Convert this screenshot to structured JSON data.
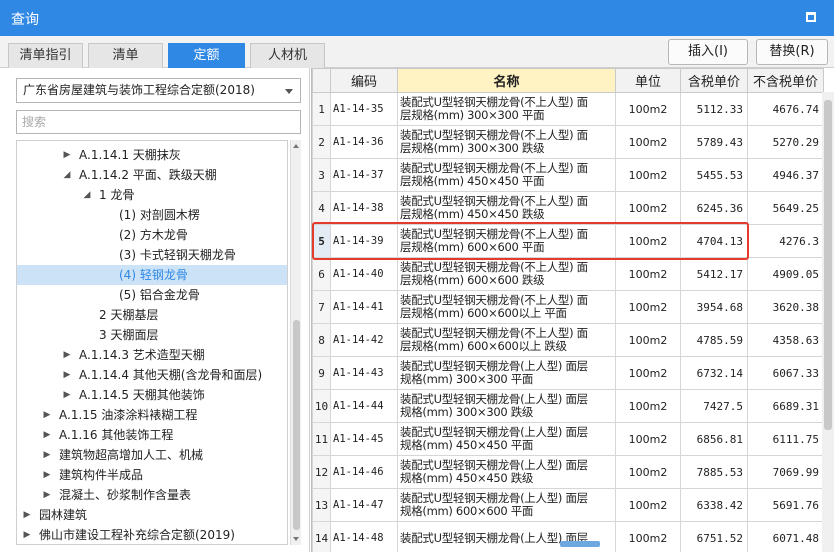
{
  "window": {
    "title": "查询"
  },
  "tabs": [
    {
      "label": "清单指引",
      "active": false
    },
    {
      "label": "清单",
      "active": false
    },
    {
      "label": "定额",
      "active": true
    },
    {
      "label": "人材机",
      "active": false
    }
  ],
  "toolbar": {
    "insert_label": "插入(I)",
    "replace_label": "替换(R)"
  },
  "left": {
    "quota_selected": "广东省房屋建筑与装饰工程综合定额(2018)",
    "search_placeholder": "搜索"
  },
  "tree": [
    {
      "label": "A.1.14.1 天棚抹灰",
      "level": 3,
      "toggle": "collapsed",
      "selected": false
    },
    {
      "label": "A.1.14.2 平面、跌级天棚",
      "level": 3,
      "toggle": "expanded",
      "selected": false
    },
    {
      "label": "1 龙骨",
      "level": 4,
      "toggle": "expanded",
      "selected": false
    },
    {
      "label": "(1) 对剖圆木楞",
      "level": 5,
      "toggle": "none",
      "selected": false
    },
    {
      "label": "(2) 方木龙骨",
      "level": 5,
      "toggle": "none",
      "selected": false
    },
    {
      "label": "(3) 卡式轻钢天棚龙骨",
      "level": 5,
      "toggle": "none",
      "selected": false
    },
    {
      "label": "(4) 轻钢龙骨",
      "level": 5,
      "toggle": "none",
      "selected": true
    },
    {
      "label": "(5) 铝合金龙骨",
      "level": 5,
      "toggle": "none",
      "selected": false
    },
    {
      "label": "2 天棚基层",
      "level": 4,
      "toggle": "none",
      "selected": false
    },
    {
      "label": "3 天棚面层",
      "level": 4,
      "toggle": "none",
      "selected": false
    },
    {
      "label": "A.1.14.3 艺术造型天棚",
      "level": 3,
      "toggle": "collapsed",
      "selected": false
    },
    {
      "label": "A.1.14.4 其他天棚(含龙骨和面层)",
      "level": 3,
      "toggle": "collapsed",
      "selected": false
    },
    {
      "label": "A.1.14.5 天棚其他装饰",
      "level": 3,
      "toggle": "collapsed",
      "selected": false
    },
    {
      "label": "A.1.15 油漆涂料裱糊工程",
      "level": 2,
      "toggle": "collapsed",
      "selected": false
    },
    {
      "label": "A.1.16 其他装饰工程",
      "level": 2,
      "toggle": "collapsed",
      "selected": false
    },
    {
      "label": "建筑物超高增加人工、机械",
      "level": 2,
      "toggle": "collapsed",
      "selected": false
    },
    {
      "label": "建筑构件半成品",
      "level": 2,
      "toggle": "collapsed",
      "selected": false
    },
    {
      "label": "混凝土、砂浆制作含量表",
      "level": 2,
      "toggle": "collapsed",
      "selected": false
    },
    {
      "label": "园林建筑",
      "level": 1,
      "toggle": "collapsed",
      "selected": false
    },
    {
      "label": "佛山市建设工程补充综合定额(2019)",
      "level": 1,
      "toggle": "collapsed",
      "selected": false
    }
  ],
  "table": {
    "headers": {
      "index": "",
      "code": "编码",
      "name": "名称",
      "unit": "单位",
      "price_tax": "含税单价",
      "price_notax": "不含税单价"
    },
    "rows": [
      {
        "index": "1",
        "code": "A1-14-35",
        "name1": "装配式U型轻钢天棚龙骨(不上人型) 面",
        "name2": "层规格(mm) 300×300 平面",
        "unit": "100m2",
        "price_tax": "5112.33",
        "price_notax": "4676.74"
      },
      {
        "index": "2",
        "code": "A1-14-36",
        "name1": "装配式U型轻钢天棚龙骨(不上人型) 面",
        "name2": "层规格(mm) 300×300 跌级",
        "unit": "100m2",
        "price_tax": "5789.43",
        "price_notax": "5270.29"
      },
      {
        "index": "3",
        "code": "A1-14-37",
        "name1": "装配式U型轻钢天棚龙骨(不上人型) 面",
        "name2": "层规格(mm) 450×450 平面",
        "unit": "100m2",
        "price_tax": "5455.53",
        "price_notax": "4946.37"
      },
      {
        "index": "4",
        "code": "A1-14-38",
        "name1": "装配式U型轻钢天棚龙骨(不上人型) 面",
        "name2": "层规格(mm) 450×450 跌级",
        "unit": "100m2",
        "price_tax": "6245.36",
        "price_notax": "5649.25"
      },
      {
        "index": "5",
        "code": "A1-14-39",
        "name1": "装配式U型轻钢天棚龙骨(不上人型) 面",
        "name2": "层规格(mm) 600×600 平面",
        "unit": "100m2",
        "price_tax": "4704.13",
        "price_notax": "4276.3"
      },
      {
        "index": "6",
        "code": "A1-14-40",
        "name1": "装配式U型轻钢天棚龙骨(不上人型) 面",
        "name2": "层规格(mm) 600×600 跌级",
        "unit": "100m2",
        "price_tax": "5412.17",
        "price_notax": "4909.05"
      },
      {
        "index": "7",
        "code": "A1-14-41",
        "name1": "装配式U型轻钢天棚龙骨(不上人型) 面",
        "name2": "层规格(mm) 600×600以上 平面",
        "unit": "100m2",
        "price_tax": "3954.68",
        "price_notax": "3620.38"
      },
      {
        "index": "8",
        "code": "A1-14-42",
        "name1": "装配式U型轻钢天棚龙骨(不上人型) 面",
        "name2": "层规格(mm) 600×600以上 跌级",
        "unit": "100m2",
        "price_tax": "4785.59",
        "price_notax": "4358.63"
      },
      {
        "index": "9",
        "code": "A1-14-43",
        "name1": "装配式U型轻钢天棚龙骨(上人型) 面层",
        "name2": "规格(mm) 300×300 平面",
        "unit": "100m2",
        "price_tax": "6732.14",
        "price_notax": "6067.33"
      },
      {
        "index": "10",
        "code": "A1-14-44",
        "name1": "装配式U型轻钢天棚龙骨(上人型) 面层",
        "name2": "规格(mm) 300×300 跌级",
        "unit": "100m2",
        "price_tax": "7427.5",
        "price_notax": "6689.31"
      },
      {
        "index": "11",
        "code": "A1-14-45",
        "name1": "装配式U型轻钢天棚龙骨(上人型) 面层",
        "name2": "规格(mm) 450×450 平面",
        "unit": "100m2",
        "price_tax": "6856.81",
        "price_notax": "6111.75"
      },
      {
        "index": "12",
        "code": "A1-14-46",
        "name1": "装配式U型轻钢天棚龙骨(上人型) 面层",
        "name2": "规格(mm) 450×450 跌级",
        "unit": "100m2",
        "price_tax": "7885.53",
        "price_notax": "7069.99"
      },
      {
        "index": "13",
        "code": "A1-14-47",
        "name1": "装配式U型轻钢天棚龙骨(上人型) 面层",
        "name2": "规格(mm) 600×600 平面",
        "unit": "100m2",
        "price_tax": "6338.42",
        "price_notax": "5691.76"
      },
      {
        "index": "14",
        "code": "A1-14-48",
        "name1": "装配式U型轻钢天棚龙骨(上人型) 面层",
        "name2": "",
        "unit": "100m2",
        "price_tax": "6751.52",
        "price_notax": "6071.48"
      }
    ]
  }
}
